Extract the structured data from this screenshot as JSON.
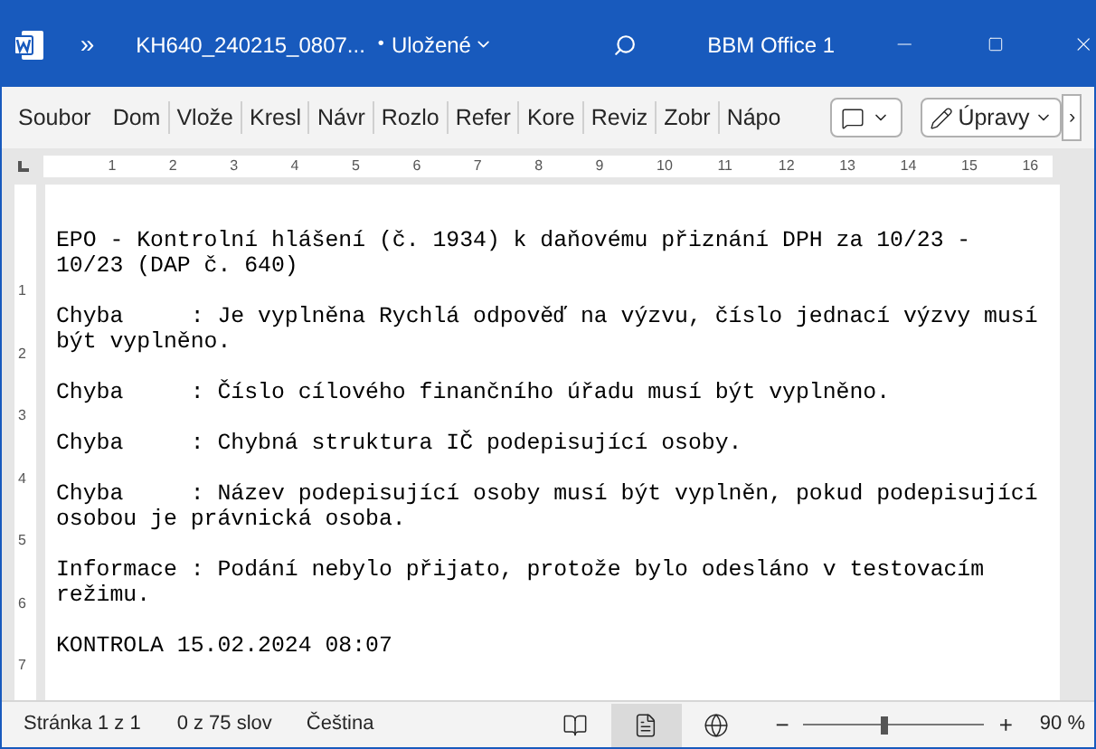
{
  "title_bar": {
    "more": "»",
    "file_name": "KH640_240215_0807...",
    "dot": "•",
    "save_status": "Uložené",
    "account": "BBM Office 1"
  },
  "ribbon": {
    "tabs": [
      {
        "label": "Soubor",
        "selected": false
      },
      {
        "label": "Dom",
        "selected": false
      },
      {
        "label": "Vlože",
        "selected": false
      },
      {
        "label": "Kresl",
        "selected": false
      },
      {
        "label": "Návr",
        "selected": false
      },
      {
        "label": "Rozlo",
        "selected": false
      },
      {
        "label": "Refer",
        "selected": false
      },
      {
        "label": "Kore",
        "selected": false
      },
      {
        "label": "Reviz",
        "selected": false
      },
      {
        "label": "Zobr",
        "selected": false
      },
      {
        "label": "Nápo",
        "selected": false
      }
    ],
    "mode_button": "Úpravy",
    "scroll_button": "›"
  },
  "ruler": {
    "horizontal": [
      "1",
      "2",
      "3",
      "4",
      "5",
      "6",
      "7",
      "8",
      "9",
      "10",
      "11",
      "12",
      "13",
      "14",
      "15",
      "16"
    ],
    "vertical": [
      "1",
      "2",
      "3",
      "4",
      "5",
      "6",
      "7"
    ]
  },
  "document": {
    "paragraphs": [
      "EPO - Kontrolní hlášení (č. 1934) k daňovému přiznání DPH za 10/23 - 10/23 (DAP č. 640)",
      "Chyba     : Je vyplněna Rychlá odpověď na výzvu, číslo jednací výzvy musí být vyplněno.",
      "Chyba     : Číslo cílového finančního úřadu musí být vyplněno.",
      "Chyba     : Chybná struktura IČ podepisující osoby.",
      "Chyba     : Název podepisující osoby musí být vyplněn, pokud podepisující osobou je právnická osoba.",
      "Informace : Podání nebylo přijato, protože bylo odesláno v testovacím režimu.",
      "KONTROLA 15.02.2024 08:07"
    ]
  },
  "status_bar": {
    "page": "Stránka 1 z 1",
    "words": "0 z 75 slov",
    "language": "Čeština",
    "views": [
      {
        "kind": "read",
        "selected": false
      },
      {
        "kind": "print",
        "selected": true
      },
      {
        "kind": "web",
        "selected": false
      }
    ],
    "zoom_minus": "−",
    "zoom_plus": "+",
    "zoom": {
      "level": 0.45
    },
    "zoom_value": "90 %"
  }
}
